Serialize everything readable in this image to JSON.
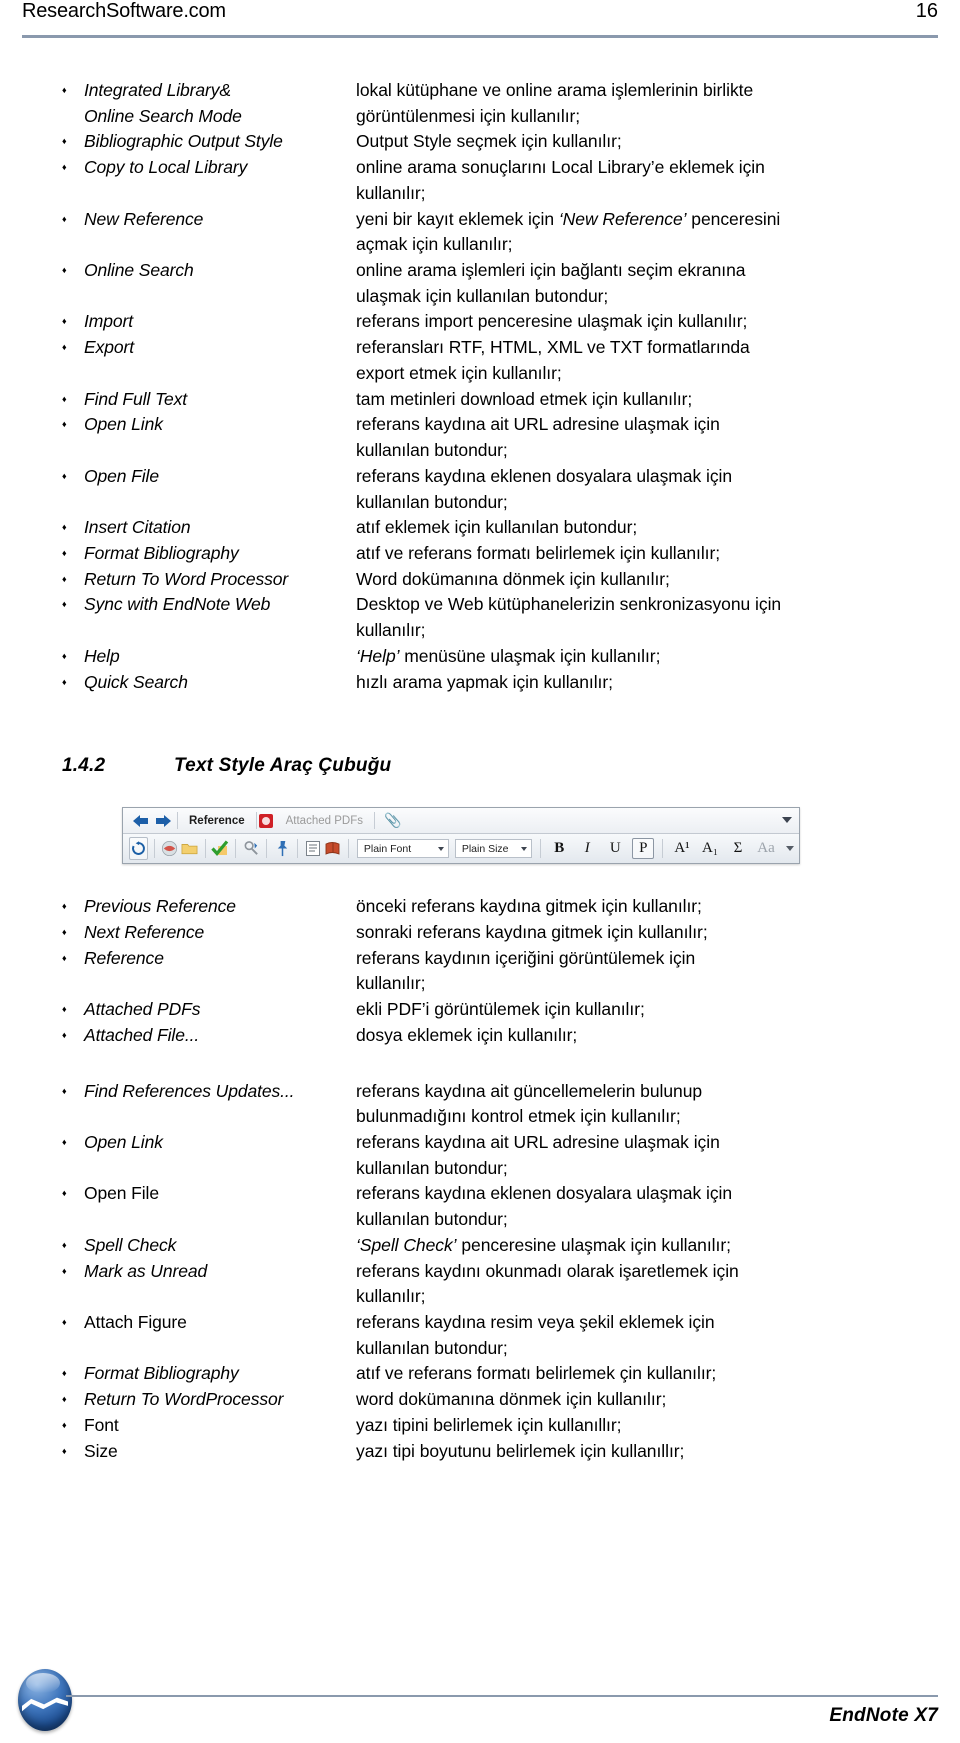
{
  "header": {
    "site": "ResearchSoftware.com",
    "page_number": "16"
  },
  "list_one": [
    {
      "bullet": true,
      "term": "Integrated Library&",
      "desc": "lokal kütüphane ve online arama işlemlerinin birlikte"
    },
    {
      "bullet": false,
      "term": "Online Search Mode",
      "desc": "görüntülenmesi için kullanılır;"
    },
    {
      "bullet": true,
      "term": "Bibliographic Output Style",
      "desc": "Output Style seçmek için kullanılır;"
    },
    {
      "bullet": true,
      "term": "Copy to Local Library",
      "desc": "online arama sonuçlarını Local Library’e eklemek için"
    },
    {
      "bullet": false,
      "term": "",
      "desc": "kullanılır;"
    },
    {
      "bullet": true,
      "term": "New Reference",
      "desc": "yeni bir kayıt eklemek için ‘New Reference’ penceresini"
    },
    {
      "bullet": false,
      "term": "",
      "desc": "açmak için kullanılır;"
    },
    {
      "bullet": true,
      "term": "Online Search",
      "desc": "online arama işlemleri için bağlantı seçim ekranına"
    },
    {
      "bullet": false,
      "term": "",
      "desc": "ulaşmak için kullanılan butondur;"
    },
    {
      "bullet": true,
      "term": "Import",
      "desc": "referans import penceresine ulaşmak için kullanılır;"
    },
    {
      "bullet": true,
      "term": "Export",
      "desc": "referansları RTF, HTML, XML ve TXT formatlarında"
    },
    {
      "bullet": false,
      "term": "",
      "desc": "export etmek için kullanılır;"
    },
    {
      "bullet": true,
      "term": "Find Full Text",
      "desc": "tam metinleri download etmek için kullanılır;"
    },
    {
      "bullet": true,
      "term": "Open Link",
      "desc": "referans kaydına ait URL adresine ulaşmak için"
    },
    {
      "bullet": false,
      "term": "",
      "desc": "kullanılan butondur;"
    },
    {
      "bullet": true,
      "term": "Open File",
      "desc": "referans kaydına eklenen dosyalara ulaşmak için"
    },
    {
      "bullet": false,
      "term": "",
      "desc": "kullanılan butondur;"
    },
    {
      "bullet": true,
      "term": "Insert Citation",
      "desc": "atıf eklemek için kullanılan butondur;"
    },
    {
      "bullet": true,
      "term": "Format Bibliography",
      "desc": "atıf ve referans formatı belirlemek için kullanılır;"
    },
    {
      "bullet": true,
      "term": "Return To Word Processor",
      "desc": "Word dokümanına dönmek için kullanılır;"
    },
    {
      "bullet": true,
      "term": "Sync with EndNote Web",
      "desc": "Desktop ve Web kütüphanelerizin senkronizasyonu için"
    },
    {
      "bullet": false,
      "term": "",
      "desc": "kullanılır;"
    },
    {
      "bullet": true,
      "term": "Help",
      "desc": "‘Help’ menüsüne ulaşmak için kullanılır;"
    },
    {
      "bullet": true,
      "term": "Quick Search",
      "desc": "hızlı arama yapmak için kullanılır;"
    }
  ],
  "section": {
    "number": "1.4.2",
    "title": "Text Style Araç Çubuğu"
  },
  "toolbar": {
    "nav": {
      "prev_icon": "arrow-left-icon",
      "next_icon": "arrow-right-icon"
    },
    "tabs": [
      {
        "label": "Reference",
        "active": true
      },
      {
        "label": "Attached PDFs",
        "active": false
      }
    ],
    "attach_icon": "paperclip-icon",
    "overflow_icon": "chevron-down-icon",
    "buttons": [
      "refresh-icon",
      "online-link-icon",
      "folder-icon",
      "spell-check-icon",
      "find-full-text-icon",
      "pushpin-icon",
      "insert-citation-icon",
      "format-bibliography-icon"
    ],
    "font_dropdown": "Plain Font",
    "size_dropdown": "Plain Size",
    "format_buttons": [
      {
        "label": "B",
        "style": "bold",
        "active": false
      },
      {
        "label": "I",
        "style": "italic",
        "active": false
      },
      {
        "label": "U",
        "style": "underline",
        "active": false
      },
      {
        "label": "P",
        "style": "plain",
        "active": true
      },
      {
        "label": "A¹",
        "style": "superscript",
        "active": false
      },
      {
        "label": "A₁",
        "style": "subscript",
        "active": false
      },
      {
        "label": "Σ",
        "style": "symbol",
        "active": false
      },
      {
        "label": "Aa",
        "style": "change-case",
        "active": false
      }
    ],
    "end_caret_icon": "chevron-down-icon"
  },
  "list_two": [
    {
      "bullet": true,
      "term": "Previous Reference",
      "roman": false,
      "desc": "önceki referans kaydına gitmek için kullanılır;"
    },
    {
      "bullet": true,
      "term": "Next Reference",
      "roman": false,
      "desc": "sonraki referans kaydına gitmek için kullanılır;"
    },
    {
      "bullet": true,
      "term": "Reference",
      "roman": false,
      "desc": "referans kaydının içeriğini görüntülemek için"
    },
    {
      "bullet": false,
      "term": "",
      "roman": false,
      "desc": "kullanılır;"
    },
    {
      "bullet": true,
      "term": "Attached PDFs",
      "roman": false,
      "desc": "ekli PDF’i görüntülemek için kullanılır;"
    },
    {
      "bullet": true,
      "term": "Attached File...",
      "roman": false,
      "desc": "dosya eklemek için kullanılır;"
    }
  ],
  "list_three": [
    {
      "bullet": true,
      "term": "Find References Updates...",
      "roman": false,
      "desc": "referans kaydına ait güncellemelerin bulunup"
    },
    {
      "bullet": false,
      "term": "",
      "roman": false,
      "desc": "bulunmadığını kontrol etmek için kullanılır;"
    },
    {
      "bullet": true,
      "term": "Open Link",
      "roman": false,
      "desc": "referans kaydına ait URL adresine ulaşmak için"
    },
    {
      "bullet": false,
      "term": "",
      "roman": false,
      "desc": "kullanılan butondur;"
    },
    {
      "bullet": true,
      "term": "Open File",
      "roman": true,
      "desc": "referans kaydına eklenen dosyalara ulaşmak için"
    },
    {
      "bullet": false,
      "term": "",
      "roman": false,
      "desc": "kullanılan butondur;"
    },
    {
      "bullet": true,
      "term": "Spell Check",
      "roman": false,
      "desc": "‘Spell Check’ penceresine ulaşmak için kullanılır;"
    },
    {
      "bullet": true,
      "term": "Mark as Unread",
      "roman": false,
      "desc": "referans kaydını okunmadı olarak işaretlemek için"
    },
    {
      "bullet": false,
      "term": "",
      "roman": false,
      "desc": "kullanılır;"
    },
    {
      "bullet": true,
      "term": "Attach Figure",
      "roman": true,
      "desc": "referans kaydına resim veya şekil eklemek için"
    },
    {
      "bullet": false,
      "term": "",
      "roman": false,
      "desc": "kullanılan butondur;"
    },
    {
      "bullet": true,
      "term": "Format Bibliography",
      "roman": false,
      "desc": "atıf ve referans formatı belirlemek çin kullanılır;"
    },
    {
      "bullet": true,
      "term": "Return To WordProcessor",
      "roman": false,
      "desc": "word dokümanına dönmek için kullanılır;"
    },
    {
      "bullet": true,
      "term": "Font",
      "roman": true,
      "desc": "yazı tipini belirlemek için kullanıllır;"
    },
    {
      "bullet": true,
      "term": "Size",
      "roman": true,
      "desc": "yazı tipi boyutunu belirlemek için kullanıllır;"
    }
  ],
  "footer": {
    "product": "EndNote X7",
    "logo_icon": "endnote-logo-icon"
  }
}
